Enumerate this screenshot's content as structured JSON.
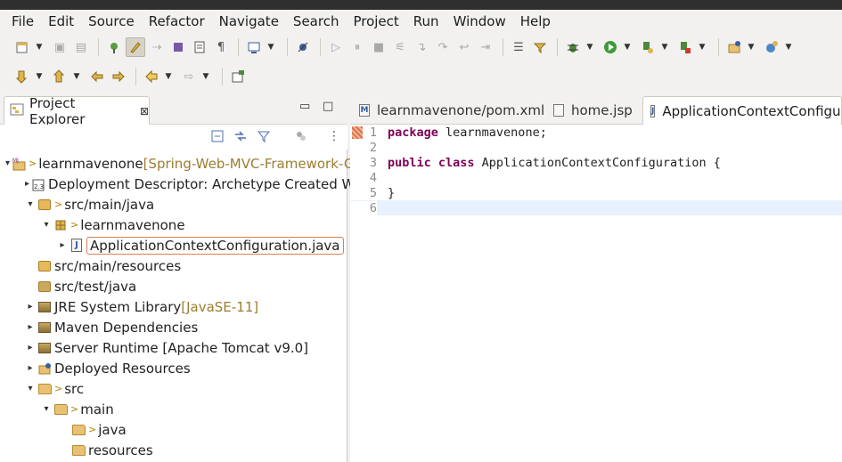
{
  "menu": [
    "File",
    "Edit",
    "Source",
    "Refactor",
    "Navigate",
    "Search",
    "Project",
    "Run",
    "Window",
    "Help"
  ],
  "explorer": {
    "title": "Project Explorer",
    "close_glyph": "⊠",
    "tree": [
      {
        "indent": 0,
        "arrow": "▾",
        "decor": ">",
        "label": "learnmavenone",
        "meta": " [Spring-Web-MVC-Framework-Gett",
        "icon": "project"
      },
      {
        "indent": 1,
        "arrow": "▸",
        "decor": "",
        "label": "Deployment Descriptor: Archetype Created Web",
        "meta": "",
        "icon": "descriptor"
      },
      {
        "indent": 1,
        "arrow": "▾",
        "decor": ">",
        "label": "src/main/java",
        "meta": "",
        "icon": "srcfolder"
      },
      {
        "indent": 2,
        "arrow": "▾",
        "decor": ">",
        "label": "learnmavenone",
        "meta": "",
        "icon": "package"
      },
      {
        "indent": 3,
        "arrow": "▸",
        "decor": "",
        "label": "ApplicationContextConfiguration.java",
        "meta": "",
        "icon": "java",
        "selected": true
      },
      {
        "indent": 1,
        "arrow": "",
        "decor": "",
        "label": "src/main/resources",
        "meta": "",
        "icon": "srcfolder"
      },
      {
        "indent": 1,
        "arrow": "",
        "decor": "",
        "label": "src/test/java",
        "meta": "",
        "icon": "srcfolder"
      },
      {
        "indent": 1,
        "arrow": "▸",
        "decor": "",
        "label": "JRE System Library",
        "meta": " [JavaSE-11]",
        "icon": "lib"
      },
      {
        "indent": 1,
        "arrow": "▸",
        "decor": "",
        "label": "Maven Dependencies",
        "meta": "",
        "icon": "lib"
      },
      {
        "indent": 1,
        "arrow": "▸",
        "decor": "",
        "label": "Server Runtime [Apache Tomcat v9.0]",
        "meta": "",
        "icon": "lib"
      },
      {
        "indent": 1,
        "arrow": "▸",
        "decor": "",
        "label": "Deployed Resources",
        "meta": "",
        "icon": "deployed"
      },
      {
        "indent": 1,
        "arrow": "▾",
        "decor": ">",
        "label": "src",
        "meta": "",
        "icon": "folder"
      },
      {
        "indent": 2,
        "arrow": "▾",
        "decor": ">",
        "label": "main",
        "meta": "",
        "icon": "folder"
      },
      {
        "indent": 3,
        "arrow": "",
        "decor": ">",
        "label": "java",
        "meta": "",
        "icon": "folder"
      },
      {
        "indent": 3,
        "arrow": "",
        "decor": "",
        "label": "resources",
        "meta": "",
        "icon": "folder"
      }
    ]
  },
  "editor": {
    "tabs": [
      {
        "label": "learnmavenone/pom.xml",
        "icon": "M",
        "active": false
      },
      {
        "label": "home.jsp",
        "icon": "",
        "active": false
      },
      {
        "label": "ApplicationContextConfigurati",
        "icon": "J",
        "active": true
      }
    ],
    "lines": [
      {
        "num": "1",
        "kw": "package",
        "rest": " learnmavenone;"
      },
      {
        "num": "2",
        "kw": "",
        "rest": ""
      },
      {
        "num": "3",
        "kw": "public class",
        "rest": " ApplicationContextConfiguration {"
      },
      {
        "num": "4",
        "kw": "",
        "rest": ""
      },
      {
        "num": "5",
        "kw": "",
        "rest": "}"
      },
      {
        "num": "6",
        "kw": "",
        "rest": ""
      }
    ]
  },
  "colors": {
    "keyword": "#7f0055",
    "selection_border": "#e07b53",
    "current_line": "#e8f2fe"
  }
}
